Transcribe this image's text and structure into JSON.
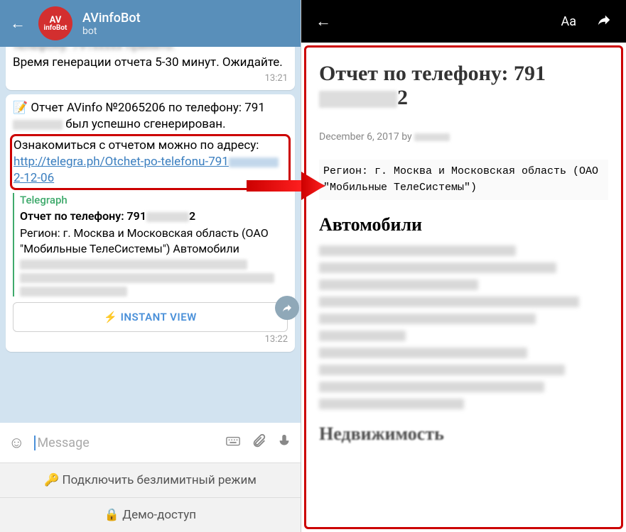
{
  "left": {
    "bot_name": "AVinfoBot",
    "bot_sub": "bot",
    "avatar": {
      "line1": "AV",
      "line2": "infoBot"
    },
    "msg1": {
      "text": "Время генерации отчета 5-30 минут. Ожидайте.",
      "time": "13:21"
    },
    "msg2": {
      "part1": "📝 Отчет AVinfo №2065206 по телефону: 791",
      "part2": " был успешно сгенерирован.",
      "highlight1": "Ознакомиться с отчетом можно по адресу: ",
      "link1": "http://telegra.ph/Otchet-po-telefonu-791",
      "link2": "2-12-06",
      "preview_source": "Telegraph",
      "preview_title1": "Отчет по телефону: 791",
      "preview_title2": "2",
      "preview_body": "Регион: г. Москва и Московская область (ОАО \"Мобильные ТелеСистемы\") Автомобили",
      "instant_view": "⚡ INSTANT VIEW",
      "time": "13:22"
    },
    "input_placeholder": "Message",
    "btn1": "🔑 Подключить безлимитный режим",
    "btn2": "🔒 Демо-доступ"
  },
  "right": {
    "header_aa": "Aa",
    "title1": "Отчет по телефону: 791",
    "title2": "2",
    "meta1": "December 6, 2017 ",
    "meta2": "by",
    "pre": "Регион: г. Москва и Московская область (ОАО \"Мобильные ТелеСистемы\")",
    "h2_1": "Автомобили",
    "h2_2": "Недвижимость"
  }
}
